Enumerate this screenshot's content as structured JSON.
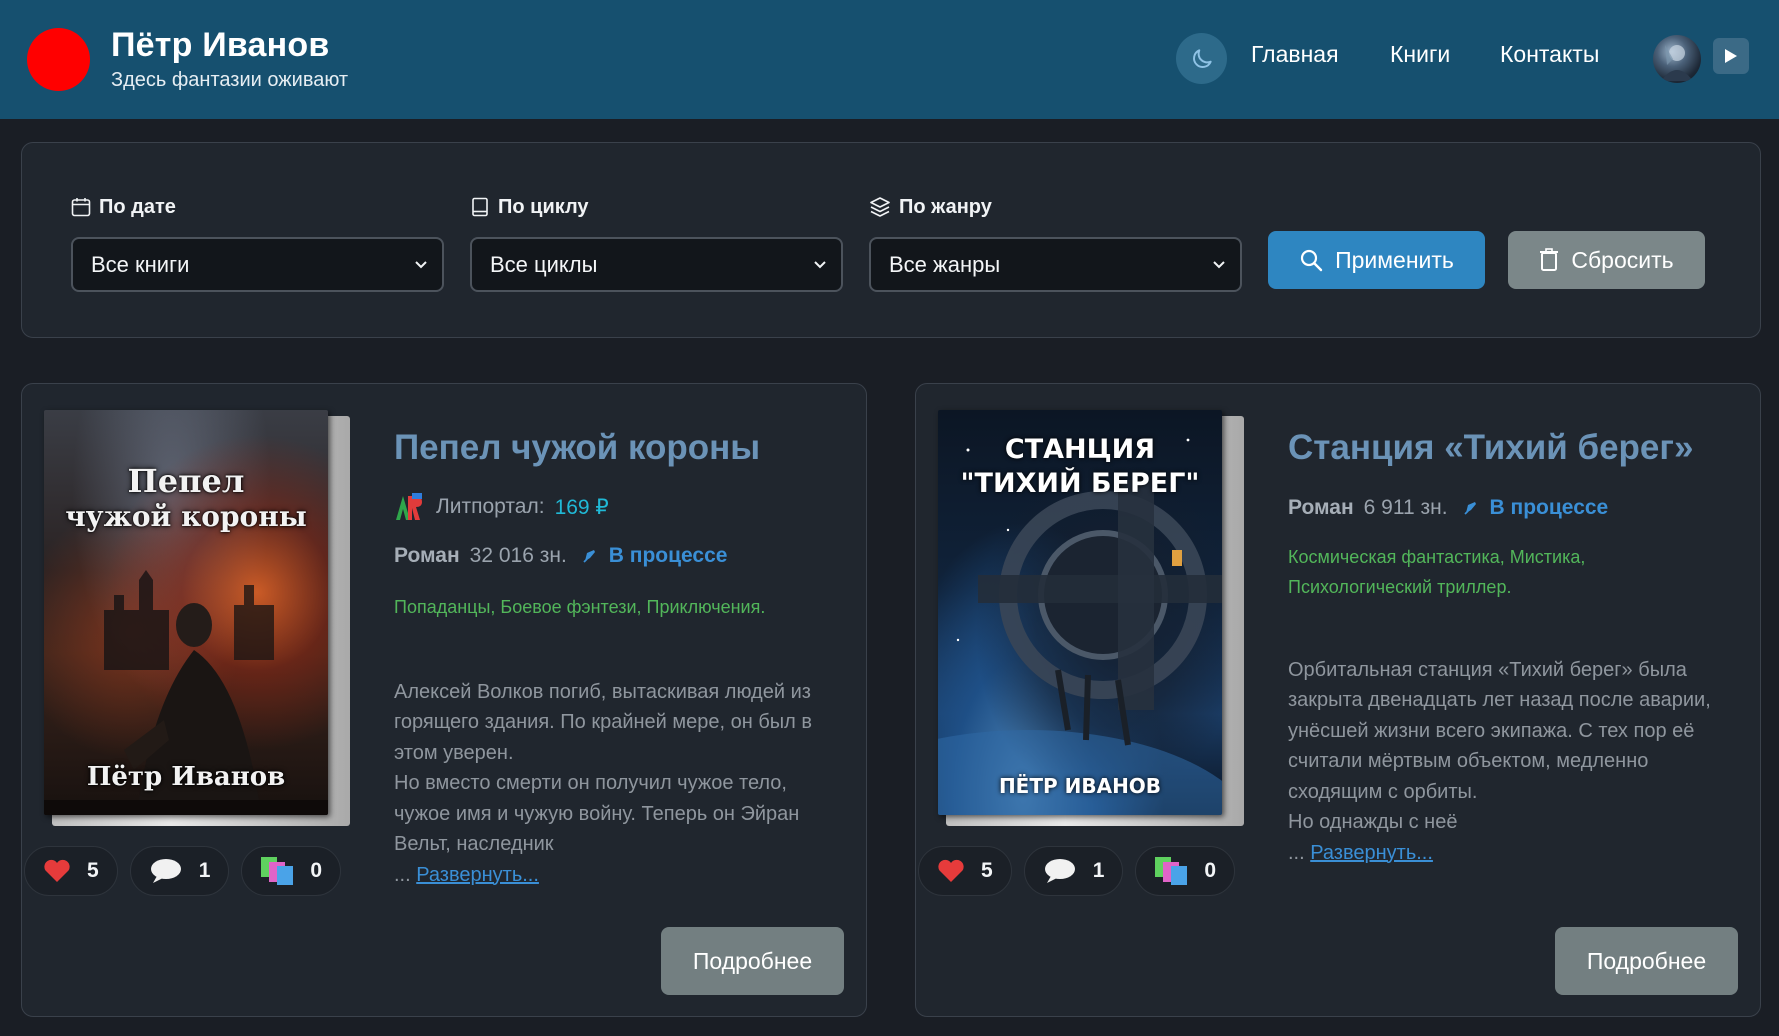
{
  "header": {
    "site_name": "Пётр Иванов",
    "tagline": "Здесь фантазии оживают",
    "nav": [
      {
        "label": "Главная"
      },
      {
        "label": "Книги"
      },
      {
        "label": "Контакты"
      }
    ],
    "icons": {
      "theme_toggle": "moon-icon",
      "avatar": "user-avatar",
      "menu": "play-icon"
    },
    "colors": {
      "header_bg": "#16506f",
      "logo": "#ff0000"
    }
  },
  "filters": {
    "date": {
      "label": "По дате",
      "value": "Все книги",
      "icon": "calendar-icon"
    },
    "cycle": {
      "label": "По циклу",
      "value": "Все циклы",
      "icon": "book-icon"
    },
    "genre": {
      "label": "По жанру",
      "value": "Все жанры",
      "icon": "layers-icon"
    },
    "apply_label": "Применить",
    "reset_label": "Сбросить"
  },
  "books": [
    {
      "title": "Пепел чужой короны",
      "cover_title_line1": "Пепел",
      "cover_title_line2": "чужой короны",
      "cover_author": "Пётр Иванов",
      "store_label": "Литпортал:",
      "price": "169 ₽",
      "type": "Роман",
      "size": "32 016 зн.",
      "status": "В процессе",
      "tags": "Попаданцы, Боевое фэнтези, Приключения.",
      "description": "Алексей Волков погиб, вытаскивая людей из\nгорящего здания. По крайней мере, он был в\nэтом уверен.\nНо вместо смерти он получил чужое тело,\nчужое имя и чужую войну. Теперь он Эйран\nВельт, наследник",
      "ellipsis": "... ",
      "expand_label": "Развернуть...",
      "likes": "5",
      "comments": "1",
      "collections": "0",
      "details_label": "Подробнее"
    },
    {
      "title": "Станция «Тихий берег»",
      "cover_title_line1": "СТАНЦИЯ",
      "cover_title_line2": "\"ТИХИЙ БЕРЕГ\"",
      "cover_author": "ПЁТР ИВАНОВ",
      "type": "Роман",
      "size": "6 911 зн.",
      "status": "В процессе",
      "tags_line1": "Космическая фантастика, Мистика,",
      "tags_line2": "Психологический триллер.",
      "description": "Орбитальная станция «Тихий берег» была\nзакрыта двенадцать лет назад после аварии,\nунёсшей жизни всего экипажа. С тех пор её\nсчитали мёртвым объектом, медленно\nсходящим с орбиты.\nНо однажды с неё",
      "ellipsis": "... ",
      "expand_label": "Развернуть...",
      "likes": "5",
      "comments": "1",
      "collections": "0",
      "details_label": "Подробнее"
    }
  ],
  "colors": {
    "page_bg": "#1a1e25",
    "card_bg": "#20262e",
    "title": "#6b93b7",
    "status": "#3a8fd6",
    "tags": "#52b65a",
    "price": "#20b9d6",
    "apply_button": "#2e86c1",
    "reset_button": "#7b8789"
  }
}
